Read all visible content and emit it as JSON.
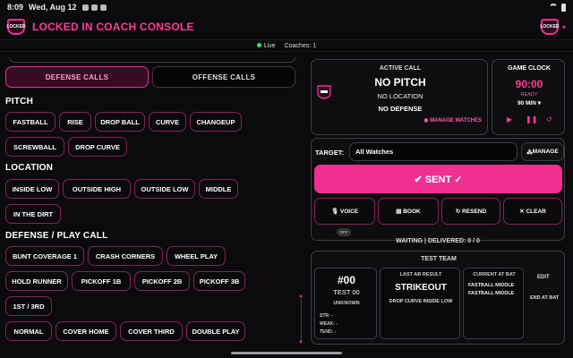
{
  "status_bar": {
    "time": "8:09",
    "date": "Wed, Aug 12"
  },
  "header": {
    "title": "LOCKED IN COACH CONSOLE",
    "logo_text": "LOCKED"
  },
  "live": {
    "status": "Live",
    "coaches": "Coaches: 1"
  },
  "segments": {
    "defense": "DEFENSE CALLS",
    "offense": "OFFENSE CALLS"
  },
  "pitch": {
    "title": "PITCH",
    "items": [
      "FASTBALL",
      "RISE",
      "DROP BALL",
      "CURVE",
      "CHANGEUP",
      "SCREWBALL",
      "DROP CURVE"
    ]
  },
  "location": {
    "title": "LOCATION",
    "items": [
      "INSIDE LOW",
      "OUTSIDE HIGH",
      "OUTSIDE LOW",
      "MIDDLE",
      "IN THE DIRT"
    ]
  },
  "defense": {
    "title": "DEFENSE / PLAY CALL",
    "items": [
      "BUNT COVERAGE 1",
      "CRASH CORNERS",
      "WHEEL PLAY",
      "HOLD RUNNER",
      "PICKOFF 1B",
      "PICKOFF 2B",
      "PICKOFF 3B",
      "1ST / 3RD",
      "NORMAL",
      "COVER HOME",
      "COVER THIRD",
      "DOUBLE PLAY"
    ]
  },
  "active_call": {
    "label": "ACTIVE CALL",
    "pitch": "NO PITCH",
    "location": "NO LOCATION",
    "defense": "NO DEFENSE",
    "manage_watches": "MANAGE WATCHES"
  },
  "game_clock": {
    "label": "GAME CLOCK",
    "value": "90:00",
    "status": "READY",
    "duration": "90 MIN"
  },
  "target": {
    "label": "TARGET:",
    "value": "All Watches",
    "manage": "MANAGE"
  },
  "actions": {
    "sent": "SENT ✓",
    "voice": "VOICE",
    "voice_toggle": "OFF",
    "book": "BOOK",
    "resend": "RESEND",
    "clear": "CLEAR"
  },
  "delivery": "WAITING | DELIVERED: 0 / 0",
  "team": {
    "label": "TEST TEAM",
    "player_number": "#00",
    "player_name": "TEST 00",
    "player_position": "UNKNOWN",
    "str": "STR: -",
    "weak": "WEAK: -",
    "tend": "TEND: -",
    "last_ab_header": "LAST AB RESULT",
    "last_ab_result": "STRIKEOUT",
    "last_ab_desc": "DROP CURVE INSIDE LOW",
    "current_header": "CURRENT AT BAT",
    "current_1": "FASTBALL MIDDLE",
    "current_2": "FASTBALL MIDDLE",
    "edit": "EDIT",
    "end_at_bat": "END AT BAT"
  },
  "colors": {
    "accent": "#ef2f92",
    "title": "#ff3c96",
    "background": "#0b0b0d"
  }
}
